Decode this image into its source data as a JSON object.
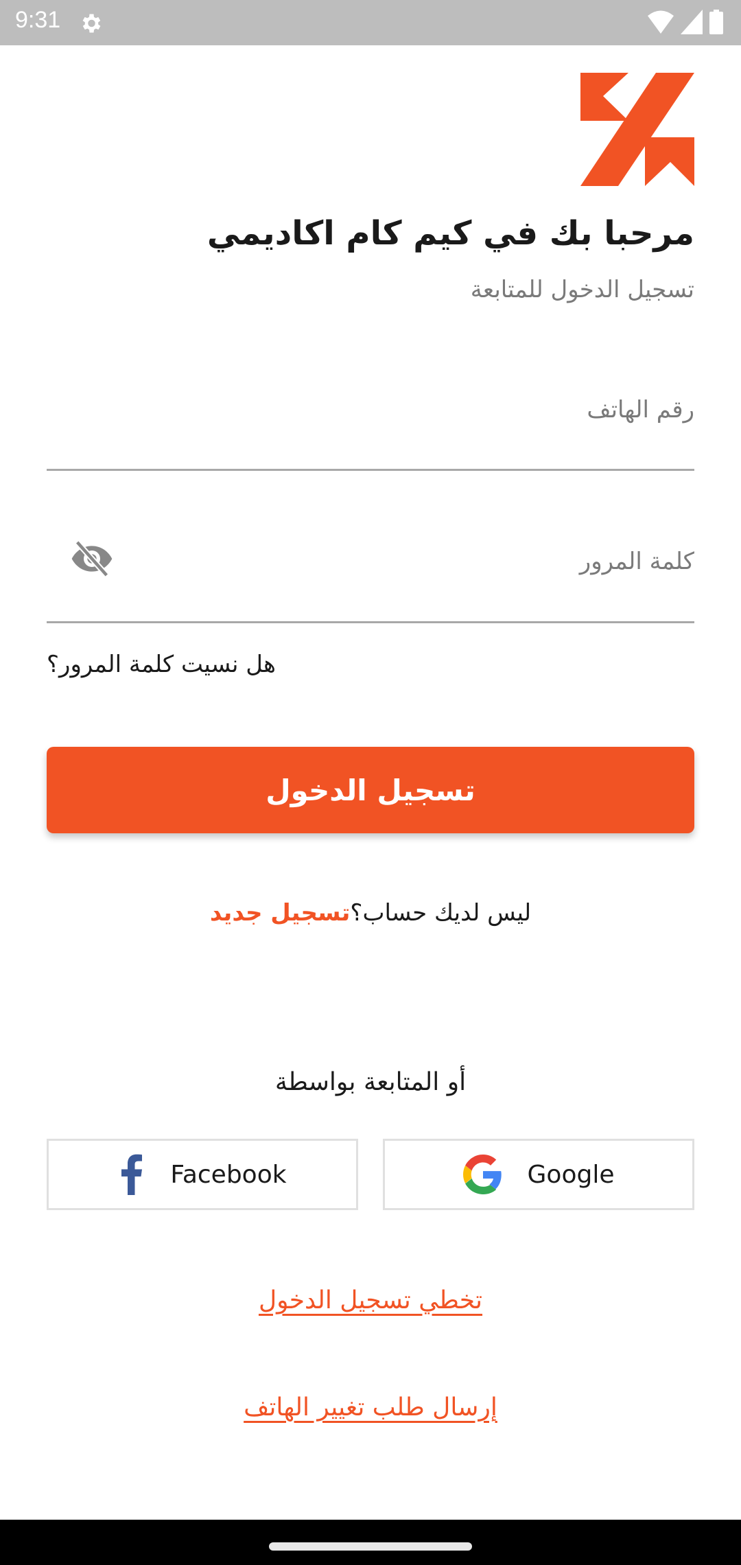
{
  "status_bar": {
    "time": "9:31",
    "icons": [
      "settings-gear-icon",
      "wifi-icon",
      "signal-icon",
      "battery-icon"
    ]
  },
  "brand": {
    "logo": "kim-kam-academy-logo",
    "accent_color": "#f15324"
  },
  "header": {
    "title": "مرحبا بك في كيم كام اكاديمي",
    "subtitle": "تسجيل الدخول للمتابعة"
  },
  "form": {
    "phone": {
      "value": "",
      "placeholder": "رقم الهاتف"
    },
    "password": {
      "value": "",
      "placeholder": "كلمة المرور",
      "toggle_icon": "eye-off-icon"
    },
    "forgot_password": "هل نسيت كلمة المرور؟",
    "login_button": "تسجيل الدخول"
  },
  "register": {
    "prompt": "ليس لديك حساب؟",
    "link": "تسجيل جديد"
  },
  "social": {
    "label": "أو المتابعة بواسطة",
    "facebook": "Facebook",
    "google": "Google"
  },
  "links": {
    "skip_login": "تخطي تسجيل الدخول",
    "change_phone": "إرسال طلب تغيير الهاتف"
  }
}
